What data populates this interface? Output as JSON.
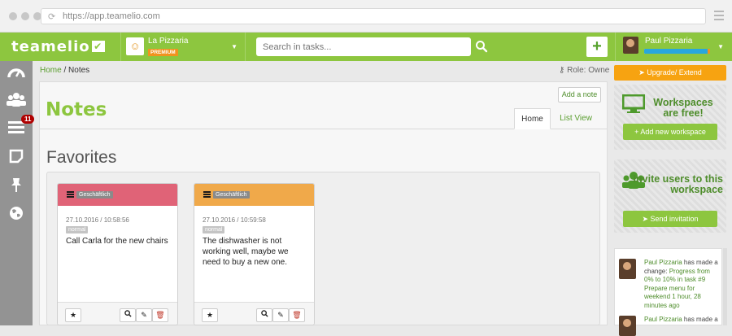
{
  "browser": {
    "url": "https://app.teamelio.com"
  },
  "header": {
    "logo": "teamelio",
    "project_name": "La Pizzaria",
    "project_badge": "PREMIUM",
    "search_placeholder": "Search in tasks...",
    "add_label": "+",
    "user_name": "Paul Pizzaria",
    "user_progress": 0.97
  },
  "sidebar": {
    "items": [
      {
        "icon": "dashboard-icon"
      },
      {
        "icon": "users-icon"
      },
      {
        "icon": "tasks-icon",
        "badge": "11"
      },
      {
        "icon": "notes-icon"
      },
      {
        "icon": "pin-icon"
      },
      {
        "icon": "globe-icon"
      }
    ]
  },
  "breadcrumb": {
    "home": "Home",
    "separator": "/",
    "current": "Notes"
  },
  "role": "Role: Owner",
  "page": {
    "title": "Notes",
    "add_note": "Add a note",
    "tabs": [
      {
        "label": "Home",
        "active": true
      },
      {
        "label": "List View",
        "active": false
      }
    ],
    "favorites_title": "Favorites"
  },
  "cards": [
    {
      "color": "#e06377",
      "tag": "Geschäftlich",
      "date": "27.10.2016 / 10:58:56",
      "priority": "normal",
      "text": "Call Carla for the new chairs"
    },
    {
      "color": "#f0a94a",
      "tag": "Geschäftlich",
      "date": "27.10.2016 / 10:59:58",
      "priority": "normal",
      "text": "The dishwasher is not working well, maybe we need to buy a new one."
    }
  ],
  "right": {
    "upgrade": "Upgrade/ Extend",
    "workspace_title": "Workspaces are free!",
    "workspace_button": "Add new workspace",
    "invite_title": "Invite users to this workspace",
    "invite_button": "Send invitation",
    "feed": [
      {
        "user": "Paul Pizzaria",
        "action": "has made a change:",
        "detail": "Progress from 0% to 10% in task #9 Prepare menu for weekend",
        "time": "1 hour, 28 minutes ago"
      },
      {
        "user": "Paul Pizzaria",
        "action": "has made a",
        "detail": "",
        "time": ""
      }
    ]
  },
  "colors": {
    "brand_green": "#8dc63f",
    "accent_orange": "#f7a311",
    "pink": "#e06377",
    "orange": "#f0a94a"
  }
}
